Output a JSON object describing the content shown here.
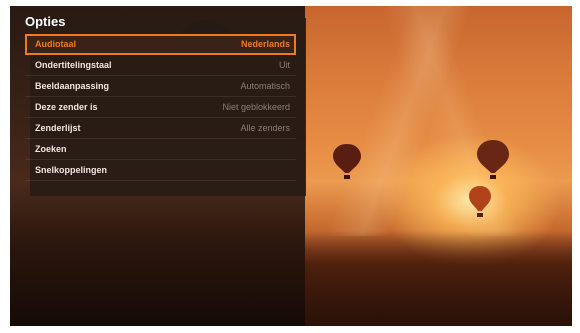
{
  "panel": {
    "title": "Opties",
    "items": [
      {
        "label": "Audiotaal",
        "value": "Nederlands",
        "selected": true
      },
      {
        "label": "Ondertitelingstaal",
        "value": "Uit",
        "selected": false
      },
      {
        "label": "Beeldaanpassing",
        "value": "Automatisch",
        "selected": false
      },
      {
        "label": "Deze zender is",
        "value": "Niet geblokkeerd",
        "selected": false
      },
      {
        "label": "Zenderlijst",
        "value": "Alle zenders",
        "selected": false
      },
      {
        "label": "Zoeken",
        "value": "",
        "selected": false
      },
      {
        "label": "Snelkoppelingen",
        "value": "",
        "selected": false
      }
    ]
  },
  "colors": {
    "accent": "#f07a1e",
    "panel_bg": "#281c16",
    "muted_value": "#8a7f78"
  }
}
